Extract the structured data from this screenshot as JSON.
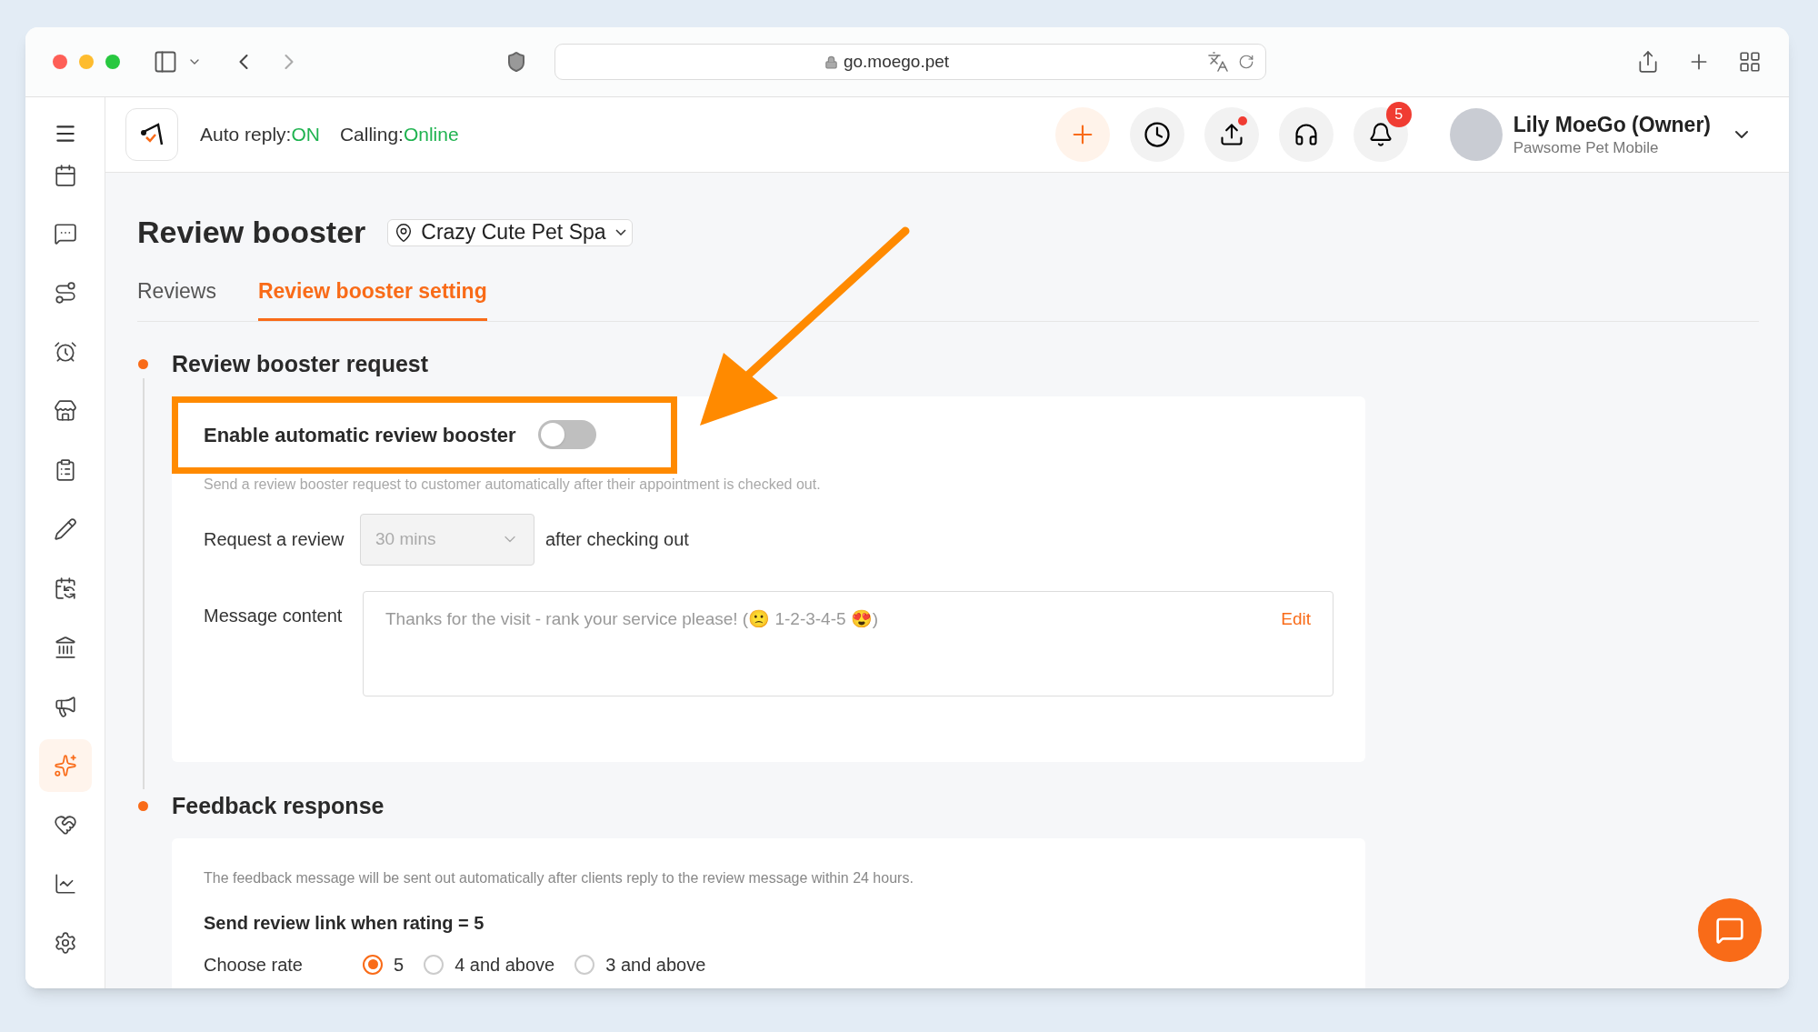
{
  "browser": {
    "url": "go.moego.pet"
  },
  "sidebar": {
    "items": [
      {
        "selected": false
      },
      {
        "selected": false
      },
      {
        "selected": false
      },
      {
        "selected": false
      },
      {
        "selected": false
      },
      {
        "selected": false
      },
      {
        "selected": false
      },
      {
        "selected": false
      },
      {
        "selected": false
      },
      {
        "selected": false
      },
      {
        "selected": true
      },
      {
        "selected": false
      },
      {
        "selected": false
      },
      {
        "selected": false
      }
    ]
  },
  "header": {
    "auto_reply": {
      "label": "Auto reply:",
      "value": "ON"
    },
    "calling": {
      "label": "Calling:",
      "value": "Online"
    },
    "notification_count": "5",
    "user": {
      "name": "Lily MoeGo (Owner)",
      "business": "Pawsome Pet Mobile"
    }
  },
  "page": {
    "title": "Review booster",
    "location": "Crazy Cute Pet Spa"
  },
  "tabs": [
    {
      "label": "Reviews",
      "selected": false
    },
    {
      "label": "Review booster setting",
      "selected": true
    }
  ],
  "request_section": {
    "title": "Review booster request",
    "toggle": {
      "label": "Enable automatic review booster",
      "on": false
    },
    "help": "Send a review booster request to customer automatically after their appointment is checked out.",
    "request": {
      "label": "Request a review",
      "value": "30 mins",
      "disabled": true,
      "suffix": "after checking out"
    },
    "message": {
      "label": "Message content",
      "text": "Thanks for the visit - rank your service please! (🙁 1-2-3-4-5 😍)",
      "edit": "Edit"
    }
  },
  "feedback_section": {
    "title": "Feedback response",
    "help": "The feedback message will be sent out automatically after clients reply to the review message within 24 hours.",
    "rule": "Send review link when rating = 5",
    "rate": {
      "label": "Choose rate",
      "options": [
        {
          "label": "5",
          "selected": true
        },
        {
          "label": "4 and above",
          "selected": false
        },
        {
          "label": "3 and above",
          "selected": false
        }
      ]
    }
  }
}
